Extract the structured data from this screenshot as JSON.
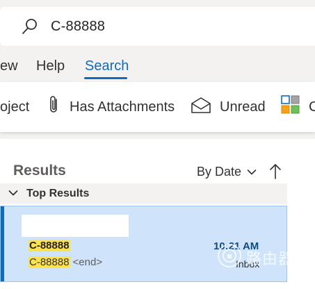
{
  "search": {
    "query": "C-88888"
  },
  "tabs": {
    "items": [
      {
        "label": "ew"
      },
      {
        "label": "Help"
      },
      {
        "label": "Search"
      }
    ],
    "active": "Search"
  },
  "toolbar": {
    "subject_label": "oject",
    "attachments_label": "Has Attachments",
    "unread_label": "Unread",
    "categorize_label": "C"
  },
  "results": {
    "title": "Results",
    "sort_label": "By Date",
    "group_label": "Top Results",
    "messages": [
      {
        "subject": "C-88888",
        "preview_match": "C-88888",
        "preview_rest": "<end>",
        "time": "10:21 AM",
        "folder": "Inbox"
      }
    ]
  },
  "watermark": {
    "text": "路由器"
  },
  "colors": {
    "accent": "#0f6cbd",
    "selected_row": "#cfe4fa",
    "highlight": "#fde24f"
  }
}
